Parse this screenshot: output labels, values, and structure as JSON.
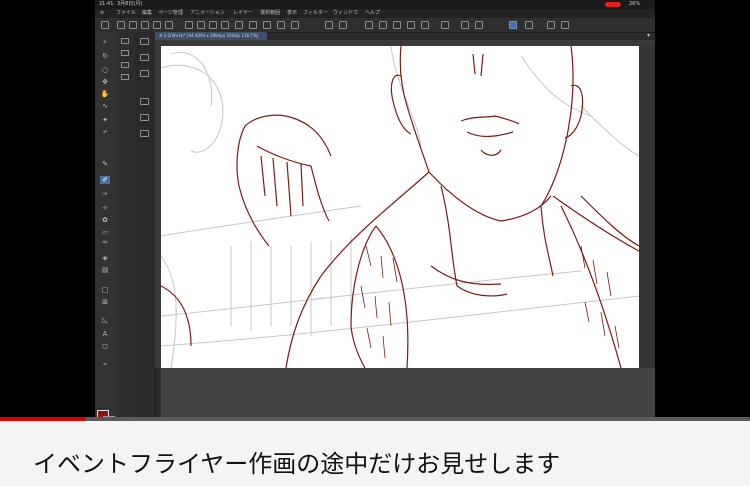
{
  "status_bar": {
    "time": "21:41",
    "date": "3月8日(月)",
    "battery": "26%"
  },
  "menu_items": [
    "ファイル",
    "編集",
    "ページ管理",
    "アニメーション",
    "レイヤー",
    "選択範囲",
    "表示",
    "フィルター",
    "ウィンドウ",
    "ヘルプ"
  ],
  "document_tab": "※ 1-2(W×H)*  (A4 4093 x 2894px 350dpi 116.7%)",
  "video": {
    "title": "イベントフライヤー作画の途中だけお見せします",
    "progress": 0.115
  },
  "colors": {
    "main_color": "#8a1212",
    "sub_color": "#ffffff",
    "progress_color": "#e00000",
    "line_color": "#7d1b14"
  }
}
